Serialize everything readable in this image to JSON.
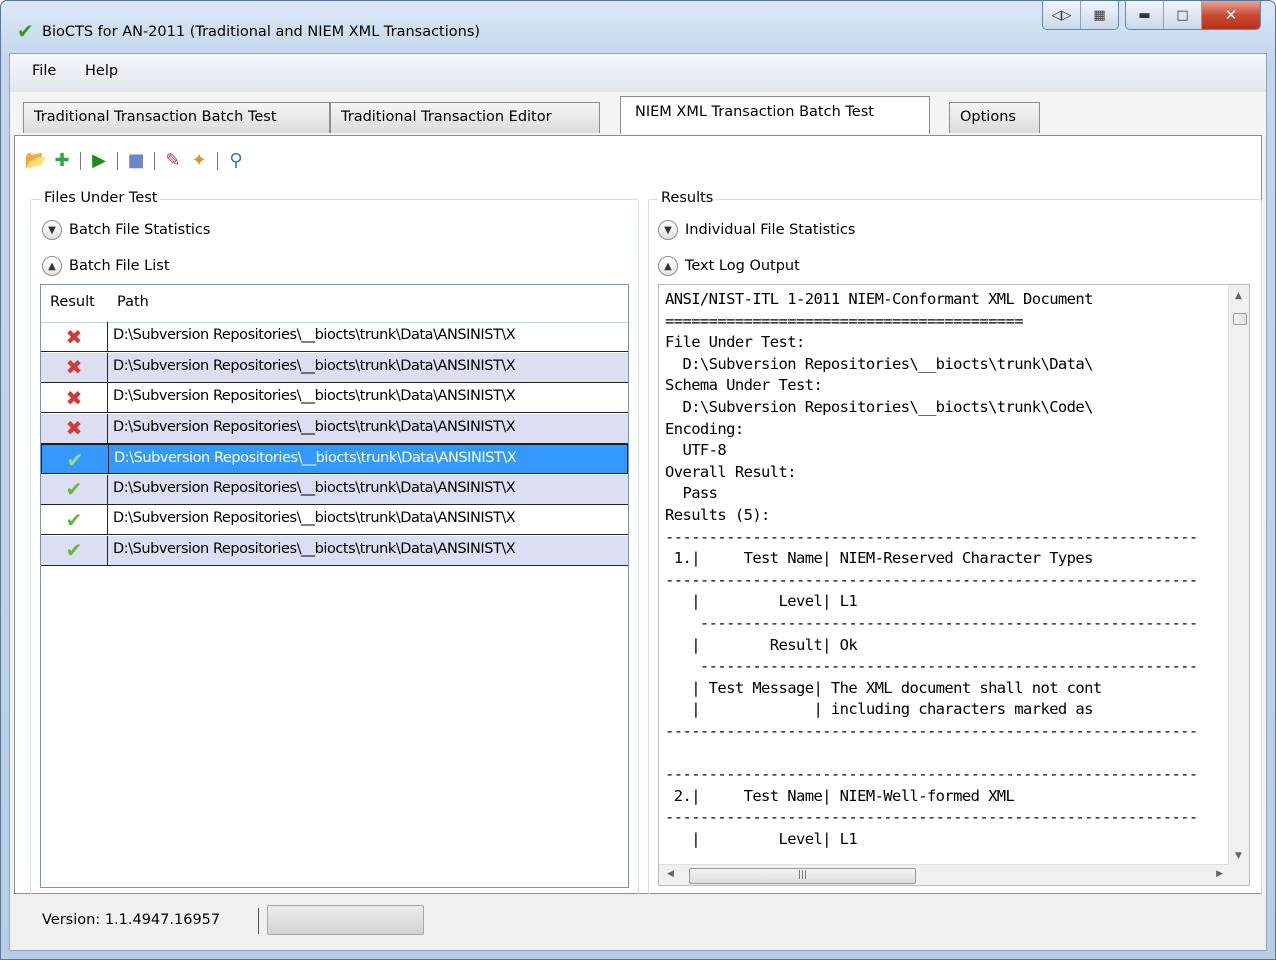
{
  "window": {
    "title": "BioCTS for AN-2011 (Traditional and NIEM XML Transactions)",
    "controls": [
      "snap-left-icon",
      "pin-icon",
      "minimize-icon",
      "maximize-icon",
      "close-icon"
    ]
  },
  "menu": {
    "file": "File",
    "help": "Help"
  },
  "tabs": [
    {
      "label": "Traditional Transaction Batch Test",
      "active": false
    },
    {
      "label": "Traditional Transaction Editor",
      "active": false
    },
    {
      "label": "NIEM XML Transaction Batch Test",
      "active": true
    },
    {
      "label": "Options",
      "active": false
    }
  ],
  "toolbar": {
    "icons": [
      "open-folder-icon",
      "add-file-icon",
      "play-icon",
      "stop-icon",
      "eraser-icon",
      "clear-broom-icon",
      "magnify-icon"
    ]
  },
  "left": {
    "group_title": "Files Under Test",
    "batch_stats": "Batch File Statistics",
    "batch_list": "Batch File List",
    "columns": {
      "result": "Result",
      "path": "Path"
    },
    "rows": [
      {
        "result": "fail",
        "path": "D:\\Subversion Repositories\\__biocts\\trunk\\Data\\ANSINIST\\X"
      },
      {
        "result": "fail",
        "path": "D:\\Subversion Repositories\\__biocts\\trunk\\Data\\ANSINIST\\X"
      },
      {
        "result": "fail",
        "path": "D:\\Subversion Repositories\\__biocts\\trunk\\Data\\ANSINIST\\X"
      },
      {
        "result": "fail",
        "path": "D:\\Subversion Repositories\\__biocts\\trunk\\Data\\ANSINIST\\X"
      },
      {
        "result": "pass",
        "path": "D:\\Subversion Repositories\\__biocts\\trunk\\Data\\ANSINIST\\X",
        "selected": true
      },
      {
        "result": "pass",
        "path": "D:\\Subversion Repositories\\__biocts\\trunk\\Data\\ANSINIST\\X"
      },
      {
        "result": "pass",
        "path": "D:\\Subversion Repositories\\__biocts\\trunk\\Data\\ANSINIST\\X"
      },
      {
        "result": "pass",
        "path": "D:\\Subversion Repositories\\__biocts\\trunk\\Data\\ANSINIST\\X"
      }
    ]
  },
  "right": {
    "group_title": "Results",
    "individual_stats": "Individual File Statistics",
    "text_log": "Text Log Output",
    "log_text": "ANSI/NIST-ITL 1-2011 NIEM-Conformant XML Document\n=========================================\nFile Under Test:\n  D:\\Subversion Repositories\\__biocts\\trunk\\Data\\\nSchema Under Test:\n  D:\\Subversion Repositories\\__biocts\\trunk\\Code\\\nEncoding:\n  UTF-8\nOverall Result:\n  Pass\nResults (5):\n-------------------------------------------------------------\n 1.|     Test Name| NIEM-Reserved Character Types\n-------------------------------------------------------------\n   |         Level| L1\n    ---------------------------------------------------------\n   |        Result| Ok\n    ---------------------------------------------------------\n   | Test Message| The XML document shall not cont\n   |             | including characters marked as\n-------------------------------------------------------------\n\n-------------------------------------------------------------\n 2.|     Test Name| NIEM-Well-formed XML\n-------------------------------------------------------------\n   |         Level| L1"
  },
  "status": {
    "version": "Version: 1.1.4947.16957",
    "progress": 0
  }
}
